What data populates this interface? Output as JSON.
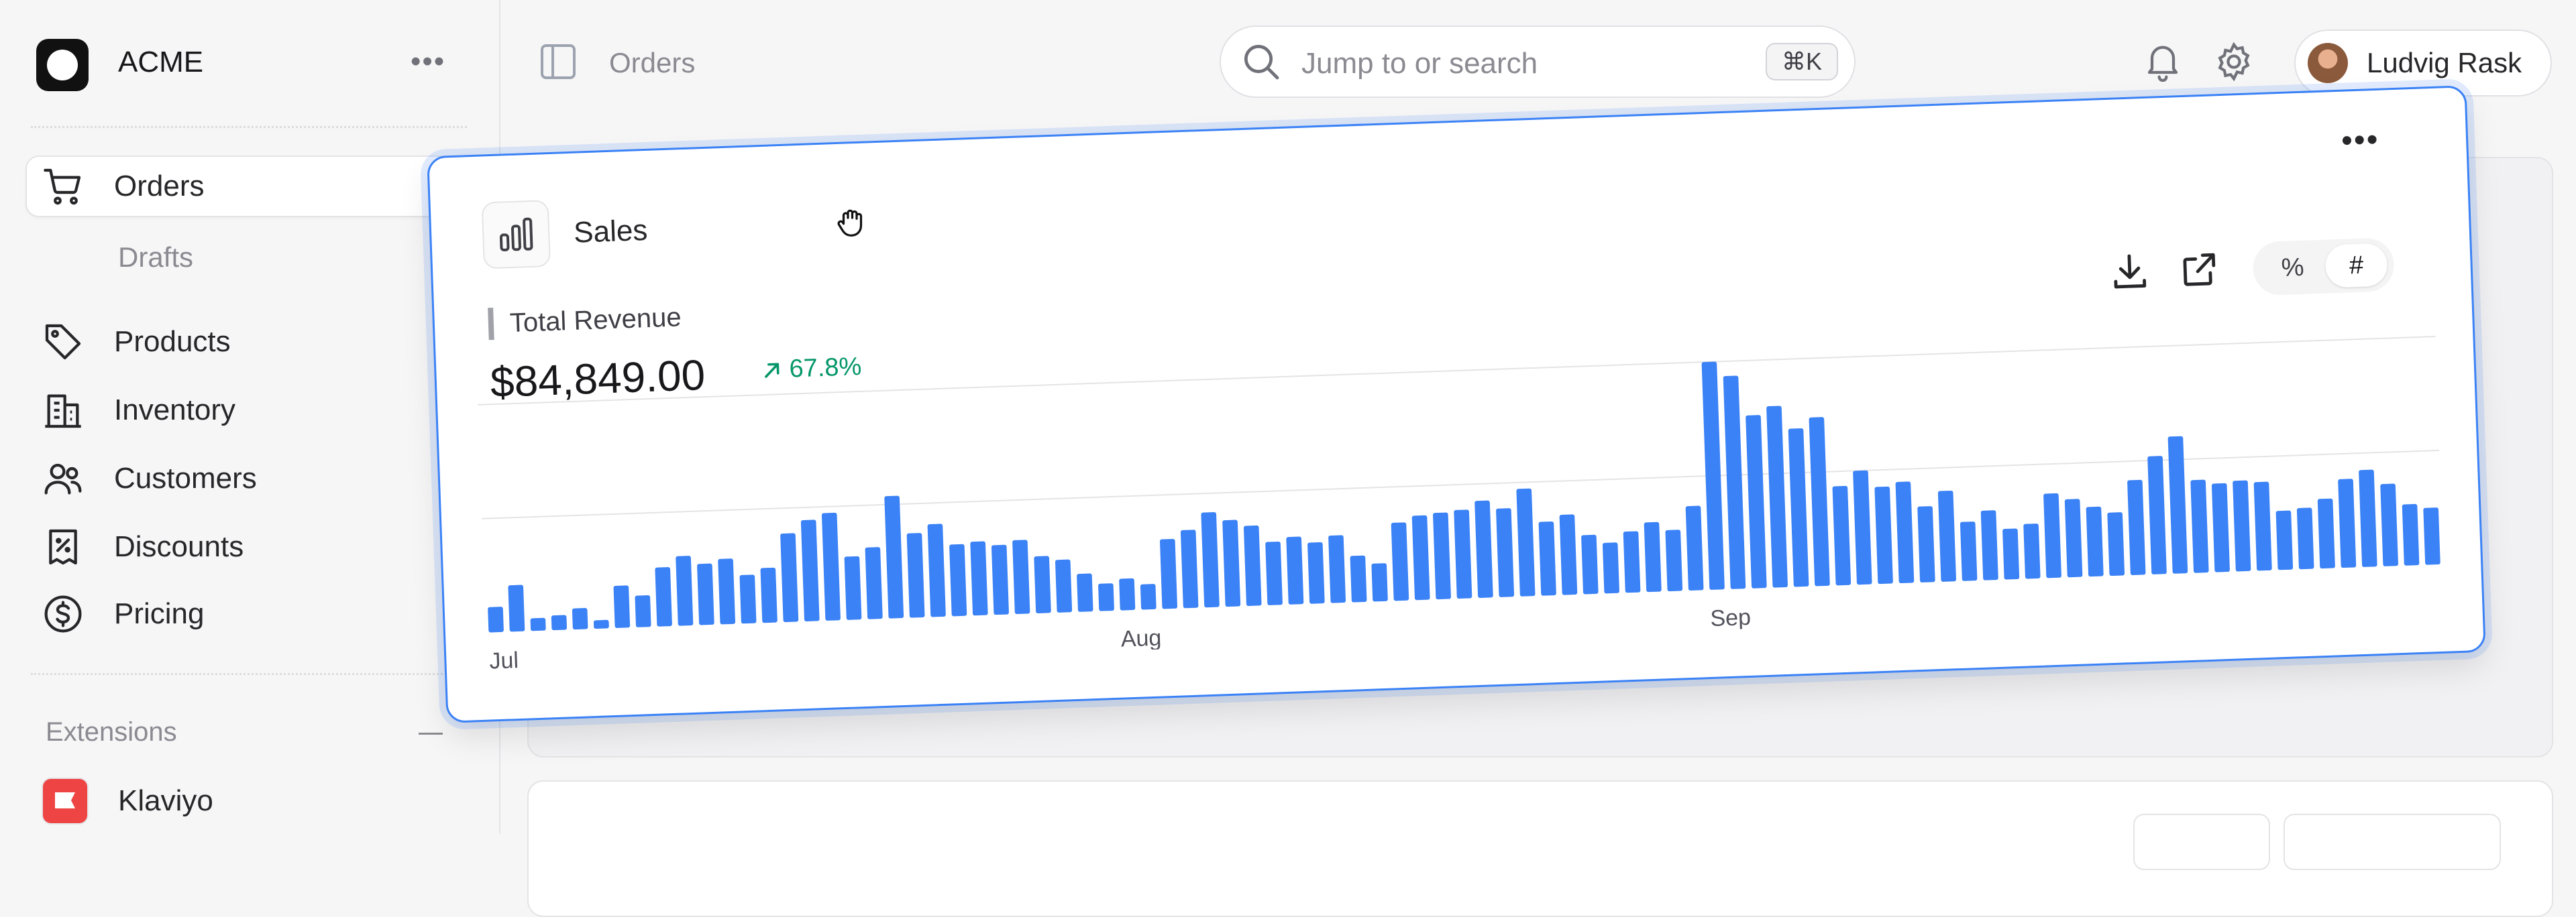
{
  "app": {
    "name": "ACME"
  },
  "sidebar": {
    "items": [
      {
        "label": "Orders",
        "icon": "cart-icon",
        "active": true
      },
      {
        "label": "Drafts",
        "sub": true
      },
      {
        "label": "Products",
        "icon": "tag-icon"
      },
      {
        "label": "Inventory",
        "icon": "building-icon"
      },
      {
        "label": "Customers",
        "icon": "users-icon"
      },
      {
        "label": "Discounts",
        "icon": "discount-icon"
      },
      {
        "label": "Pricing",
        "icon": "dollar-circle-icon"
      }
    ],
    "extensions_title": "Extensions",
    "extensions": [
      {
        "label": "Klaviyo",
        "color": "#ef4444"
      }
    ]
  },
  "topbar": {
    "breadcrumb": "Orders",
    "search_placeholder": "Jump to or search",
    "shortcut": "⌘K",
    "user_name": "Ludvig Rask"
  },
  "sales_card": {
    "title": "Sales",
    "metric_label": "Total Revenue",
    "metric_value": "$84,849.00",
    "delta": "67.8%",
    "toggle": {
      "percent": "%",
      "count": "#",
      "selected": "#"
    },
    "accent": "#3b82f6",
    "positive": "#059669"
  },
  "chart_data": {
    "type": "bar",
    "x_ticks": [
      "Jul",
      "Aug",
      "Sep"
    ],
    "x_tick_index": [
      0,
      30,
      58
    ],
    "values": [
      12,
      22,
      6,
      7,
      10,
      4,
      20,
      15,
      28,
      33,
      29,
      31,
      23,
      26,
      42,
      48,
      51,
      30,
      34,
      58,
      40,
      44,
      34,
      35,
      33,
      35,
      27,
      25,
      18,
      13,
      15,
      12,
      33,
      37,
      45,
      41,
      38,
      30,
      32,
      29,
      32,
      22,
      18,
      37,
      40,
      41,
      42,
      46,
      42,
      51,
      35,
      38,
      28,
      24,
      29,
      33,
      29,
      40,
      108,
      101,
      82,
      86,
      75,
      80,
      47,
      54,
      46,
      48,
      36,
      43,
      28,
      33,
      24,
      26,
      40,
      37,
      33,
      30,
      45,
      56,
      65,
      44,
      42,
      43,
      42,
      28,
      29,
      33,
      42,
      46,
      39,
      29,
      27
    ]
  }
}
